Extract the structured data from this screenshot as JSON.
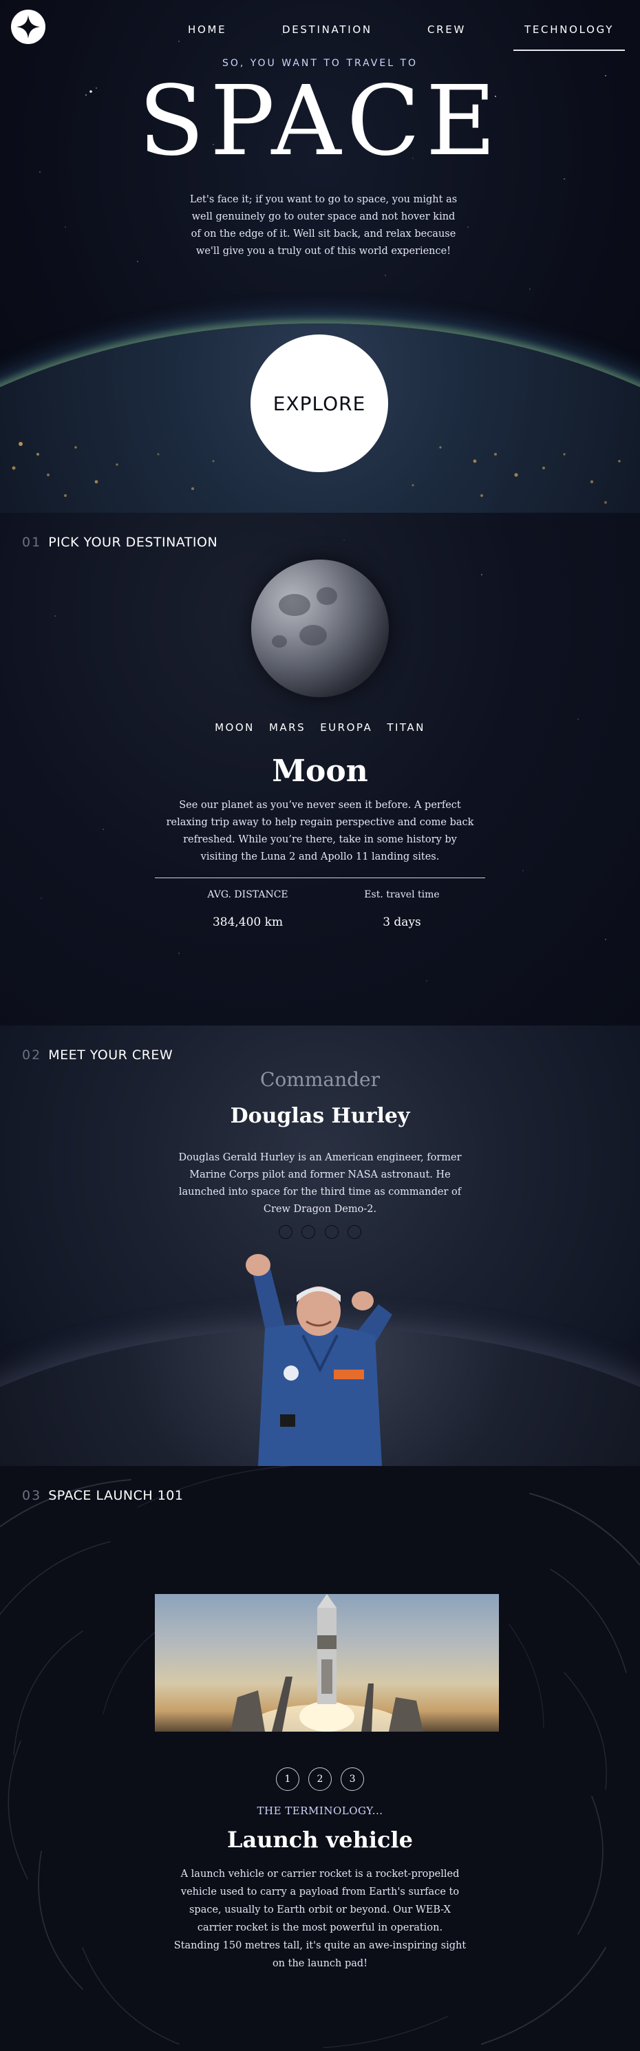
{
  "header": {
    "logo_icon": "star-logo-icon",
    "nav": [
      {
        "label": "HOME"
      },
      {
        "label": "DESTINATION"
      },
      {
        "label": "CREW"
      },
      {
        "label": "TECHNOLOGY",
        "active": true
      }
    ]
  },
  "hero": {
    "eyebrow": "SO, YOU WANT TO TRAVEL TO",
    "title": "SPACE",
    "text": "Let's face it; if you want to go to space, you might as well genuinely go to outer space and not hover kind of on the edge of it. Well sit back, and relax because we'll give you a truly out of this world experience!",
    "explore_label": "EXPLORE"
  },
  "destination": {
    "number": "01",
    "heading": "PICK YOUR DESTINATION",
    "tabs": [
      {
        "label": "MOON"
      },
      {
        "label": "MARS"
      },
      {
        "label": "EUROPA"
      },
      {
        "label": "TITAN"
      }
    ],
    "name": "Moon",
    "description": "See our planet as you’ve never seen it before. A perfect relaxing trip away to help regain perspective and come back refreshed. While you’re there, take in some history by visiting the Luna 2 and Apollo 11 landing sites.",
    "distance_label": "AVG. DISTANCE",
    "distance_value": "384,400 km",
    "travel_label": "Est. travel time",
    "travel_value": "3 days"
  },
  "crew": {
    "number": "02",
    "heading": "MEET YOUR CREW",
    "role": "Commander",
    "name": "Douglas Hurley",
    "bio": "Douglas Gerald Hurley is an American engineer, former Marine Corps pilot and former NASA astronaut. He launched into space for the third time as commander of Crew Dragon Demo-2.",
    "dots": 4
  },
  "technology": {
    "number": "03",
    "heading": "SPACE LAUNCH 101",
    "pages": [
      "1",
      "2",
      "3"
    ],
    "eyebrow": "THE TERMINOLOGY...",
    "name": "Launch vehicle",
    "description": "A launch vehicle or carrier rocket is a rocket-propelled vehicle used to carry a payload from Earth's surface to space, usually to Earth orbit or beyond. Our WEB-X carrier rocket is the most powerful in operation. Standing 150 metres tall, it's quite an awe-inspiring sight on the launch pad!"
  },
  "colors": {
    "background": "#0b0d17",
    "accent": "#d0d6f9",
    "white": "#ffffff"
  }
}
